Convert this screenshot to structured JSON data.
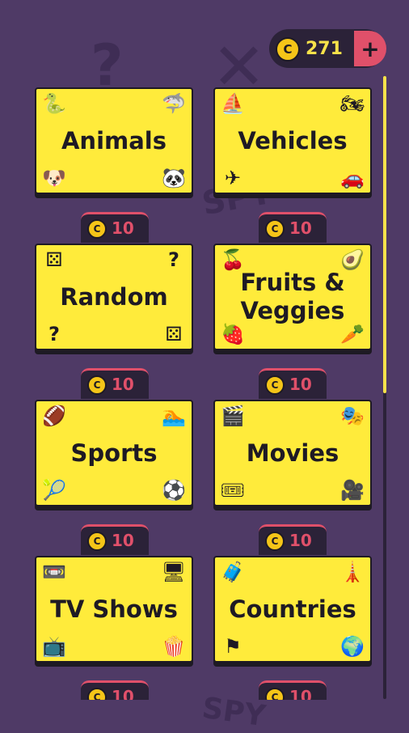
{
  "wallet": {
    "coins": "271",
    "coin_symbol": "C",
    "add_label": "+"
  },
  "categories": [
    {
      "title": "Animals",
      "icons": [
        "snake-icon",
        "shark-icon",
        "dog-icon",
        "panda-icon"
      ]
    },
    {
      "title": "Vehicles",
      "icons": [
        "sailboat-icon",
        "motorcycle-icon",
        "airplane-icon",
        "car-icon"
      ]
    },
    {
      "title": "Random",
      "price": "10",
      "icons": [
        "dice-icon",
        "question-icon",
        "question-icon",
        "dice-icon"
      ]
    },
    {
      "title": "Fruits & Veggies",
      "price": "10",
      "icons": [
        "cherries-icon",
        "avocado-icon",
        "strawberry-icon",
        "carrot-icon"
      ]
    },
    {
      "title": "Sports",
      "price": "10",
      "icons": [
        "football-icon",
        "swimmer-icon",
        "tennis-icon",
        "soccer-ball-icon"
      ]
    },
    {
      "title": "Movies",
      "price": "10",
      "icons": [
        "clapperboard-icon",
        "theater-masks-icon",
        "ticket-icon",
        "movie-camera-icon"
      ]
    },
    {
      "title": "TV Shows",
      "price": "10",
      "icons": [
        "vhs-tape-icon",
        "computer-icon",
        "television-icon",
        "popcorn-icon"
      ]
    },
    {
      "title": "Countries",
      "price": "10",
      "icons": [
        "luggage-icon",
        "eiffel-tower-icon",
        "flag-icon",
        "globe-icon"
      ]
    }
  ],
  "next_row_prices": [
    "10",
    "10"
  ],
  "colors": {
    "background": "#4f3a66",
    "card": "#ffeb3b",
    "coin": "#f5c518",
    "accent": "#e0506a",
    "dark": "#2b2238"
  }
}
